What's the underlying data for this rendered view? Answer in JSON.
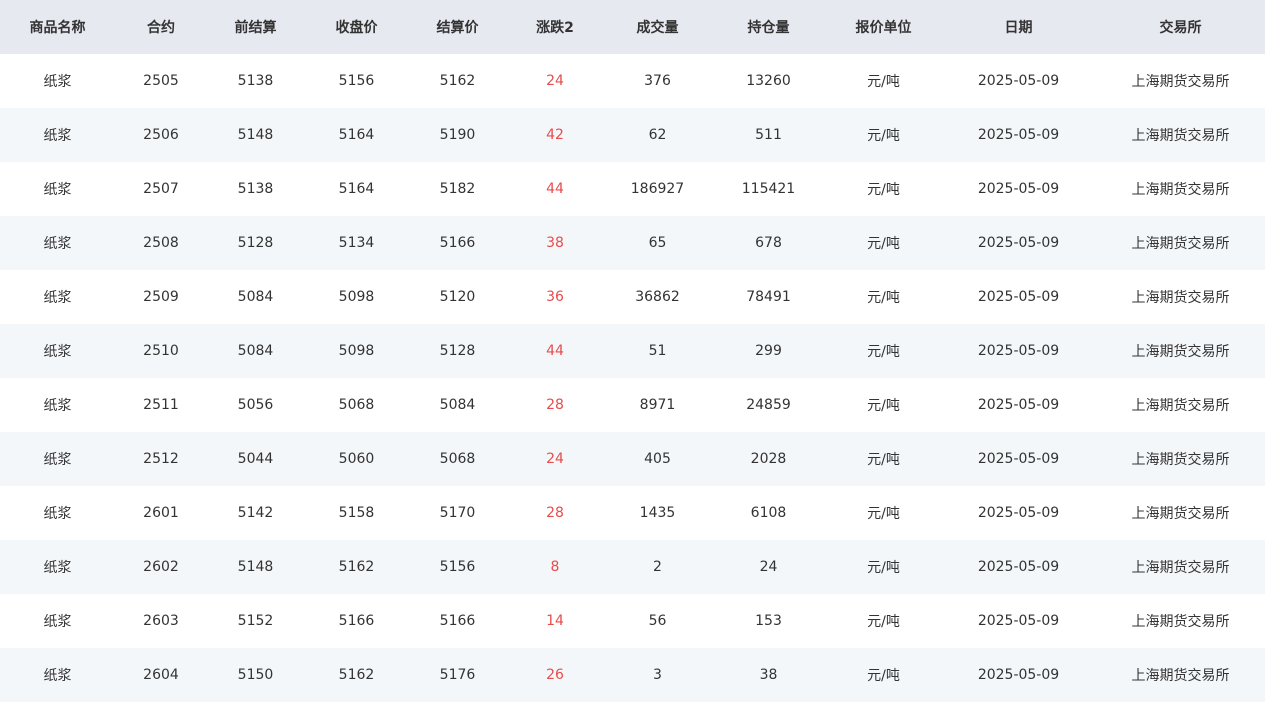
{
  "table": {
    "headers": [
      "商品名称",
      "合约",
      "前结算",
      "收盘价",
      "结算价",
      "涨跌2",
      "成交量",
      "持仓量",
      "报价单位",
      "日期",
      "交易所"
    ],
    "rows": [
      [
        "纸浆",
        "2505",
        "5138",
        "5156",
        "5162",
        "24",
        "376",
        "13260",
        "元/吨",
        "2025-05-09",
        "上海期货交易所"
      ],
      [
        "纸浆",
        "2506",
        "5148",
        "5164",
        "5190",
        "42",
        "62",
        "511",
        "元/吨",
        "2025-05-09",
        "上海期货交易所"
      ],
      [
        "纸浆",
        "2507",
        "5138",
        "5164",
        "5182",
        "44",
        "186927",
        "115421",
        "元/吨",
        "2025-05-09",
        "上海期货交易所"
      ],
      [
        "纸浆",
        "2508",
        "5128",
        "5134",
        "5166",
        "38",
        "65",
        "678",
        "元/吨",
        "2025-05-09",
        "上海期货交易所"
      ],
      [
        "纸浆",
        "2509",
        "5084",
        "5098",
        "5120",
        "36",
        "36862",
        "78491",
        "元/吨",
        "2025-05-09",
        "上海期货交易所"
      ],
      [
        "纸浆",
        "2510",
        "5084",
        "5098",
        "5128",
        "44",
        "51",
        "299",
        "元/吨",
        "2025-05-09",
        "上海期货交易所"
      ],
      [
        "纸浆",
        "2511",
        "5056",
        "5068",
        "5084",
        "28",
        "8971",
        "24859",
        "元/吨",
        "2025-05-09",
        "上海期货交易所"
      ],
      [
        "纸浆",
        "2512",
        "5044",
        "5060",
        "5068",
        "24",
        "405",
        "2028",
        "元/吨",
        "2025-05-09",
        "上海期货交易所"
      ],
      [
        "纸浆",
        "2601",
        "5142",
        "5158",
        "5170",
        "28",
        "1435",
        "6108",
        "元/吨",
        "2025-05-09",
        "上海期货交易所"
      ],
      [
        "纸浆",
        "2602",
        "5148",
        "5162",
        "5156",
        "8",
        "2",
        "24",
        "元/吨",
        "2025-05-09",
        "上海期货交易所"
      ],
      [
        "纸浆",
        "2603",
        "5152",
        "5166",
        "5166",
        "14",
        "56",
        "153",
        "元/吨",
        "2025-05-09",
        "上海期货交易所"
      ],
      [
        "纸浆",
        "2604",
        "5150",
        "5162",
        "5176",
        "26",
        "3",
        "38",
        "元/吨",
        "2025-05-09",
        "上海期货交易所"
      ]
    ]
  },
  "colors": {
    "change_positive": "#e84c4c",
    "header_bg": "#e6e9f0",
    "stripe_bg": "#f4f7fa"
  }
}
